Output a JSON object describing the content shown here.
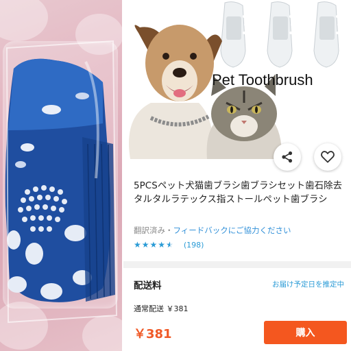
{
  "product_image": {
    "title_overlay": "Pet Toothbrush"
  },
  "actions": {
    "share_icon": "share-icon",
    "favorite_icon": "heart-icon"
  },
  "product": {
    "title": "5PCSペット犬猫歯ブラシ歯ブラシセット歯石除去タルタルラテックス指ストールペット歯ブラシ",
    "translated_label": "翻訳済み・",
    "feedback_link": "フィードバックにご協力ください",
    "rating": {
      "stars": 4.5,
      "count_text": "(198)"
    }
  },
  "shipping": {
    "label": "配送料",
    "delivery_estimate": "お届け予定日を推定中",
    "fee_text": "通常配送 ￥381"
  },
  "price": "￥381",
  "buy_button": "購入",
  "colors": {
    "accent": "#f4571f",
    "price": "#f05a28",
    "link": "#2a9bd6"
  }
}
